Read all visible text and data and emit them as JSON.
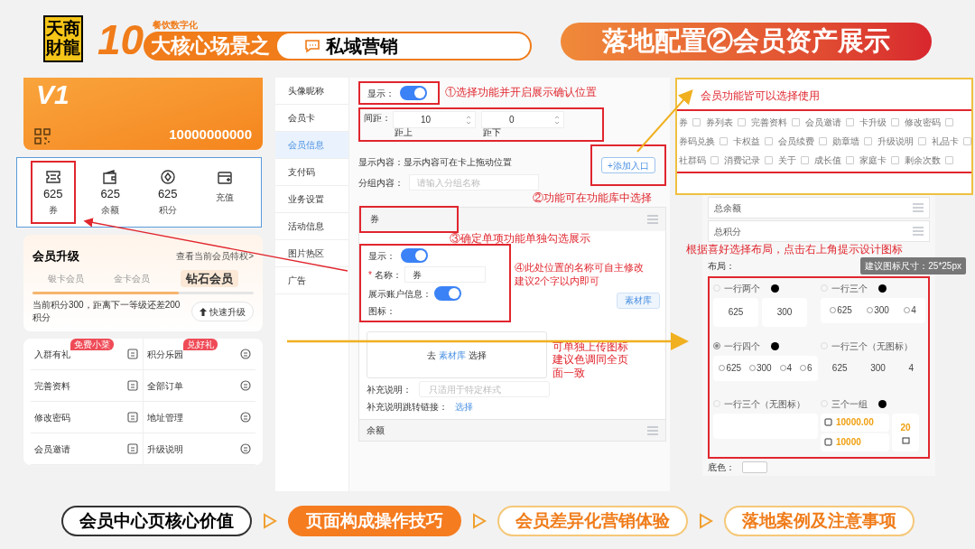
{
  "header": {
    "brand": "天商財龍",
    "series_tag": "餐饮数字化",
    "series_number": "10",
    "series_title": "大核心场景之",
    "topic": "私域营销",
    "slide_title": "落地配置②会员资产展示"
  },
  "phone": {
    "card_badge": "V1",
    "card_number": "10000000000",
    "assets": [
      {
        "kind": "stat",
        "value": "625",
        "label": "券",
        "highlighted": true
      },
      {
        "kind": "stat",
        "value": "625",
        "label": "余额",
        "highlighted": false
      },
      {
        "kind": "stat",
        "value": "625",
        "label": "积分",
        "highlighted": false
      },
      {
        "kind": "action",
        "label": "充值",
        "highlighted": false
      }
    ],
    "upgrade": {
      "title": "会员升级",
      "link": "查看当前会员特权>",
      "levels": [
        {
          "name": "银卡会员",
          "current": false
        },
        {
          "name": "金卡会员",
          "current": false
        },
        {
          "name": "钻石会员",
          "current": true
        }
      ],
      "level": 0.66,
      "note": "当前积分300，距离下一等级还差200积分",
      "button": "快速升级"
    },
    "menu": [
      {
        "label": "入群有礼",
        "badge": "免费小菜"
      },
      {
        "label": "积分乐园",
        "badge": "兑好礼"
      },
      {
        "label": "完善资料"
      },
      {
        "label": "全部订单"
      },
      {
        "label": "修改密码"
      },
      {
        "label": "地址管理"
      },
      {
        "label": "会员邀请"
      },
      {
        "label": "升级说明"
      }
    ]
  },
  "sidebar": {
    "items": [
      {
        "label": "头像昵称",
        "selected": false
      },
      {
        "label": "会员卡",
        "selected": false
      },
      {
        "label": "会员信息",
        "selected": true
      },
      {
        "label": "支付码",
        "selected": false
      },
      {
        "label": "业务设置",
        "selected": false
      },
      {
        "label": "活动信息",
        "selected": false
      },
      {
        "label": "图片热区",
        "selected": false
      },
      {
        "label": "广告",
        "selected": false
      }
    ]
  },
  "editor": {
    "show_label": "显示：",
    "show_on": true,
    "spacing_label": "间距：",
    "spacing": [
      {
        "value": "10",
        "caption": "距上"
      },
      {
        "value": "0",
        "caption": "距下"
      }
    ],
    "content_label": "显示内容：显示内容可在卡上拖动位置",
    "add_button": "+添加入口",
    "group_label": "分组内容：",
    "group_placeholder": "请输入分组名称",
    "item": {
      "title": "券",
      "show_label": "显示：",
      "show_on": true,
      "required_mark": "*",
      "name_label": "名称：",
      "name_value": "券",
      "account_label": "展示账户信息：",
      "account_on": true,
      "icon_label": "图标：",
      "library_button": "素材库",
      "upload_prefix": "去",
      "upload_link": "素材库",
      "upload_suffix": "选择",
      "note_label": "补充说明：",
      "note_placeholder": "只适用于特定样式",
      "link_label": "补充说明跳转链接：",
      "link_value": "选择"
    },
    "next_section": "余额"
  },
  "annotations": {
    "step1": "①选择功能并开启展示确认位置",
    "step2": "②功能可在功能库中选择",
    "step3": "③确定单项功能单独勾选展示",
    "step4": [
      "④此处位置的名称可自主修改",
      "建议2个字以内即可"
    ],
    "upload_note": [
      "可单独上传图标",
      "建议色调同全页",
      "面一致"
    ],
    "library_note": "会员功能皆可以选择使用",
    "layout_note": "根据喜好选择布局，点击右上角提示设计图标"
  },
  "library": {
    "rows": [
      [
        {
          "label": "券",
          "checked": false
        },
        {
          "label": "券列表",
          "checked": false
        },
        {
          "label": "完善资料",
          "checked": false
        },
        {
          "label": "会员邀请",
          "checked": false
        },
        {
          "label": "卡升级",
          "checked": false
        },
        {
          "label": "修改密码",
          "checked": false
        }
      ],
      [
        {
          "label": "券码兑换",
          "checked": false
        },
        {
          "label": "卡权益",
          "checked": false
        },
        {
          "label": "会员续费",
          "checked": false
        },
        {
          "label": "勋章墙",
          "checked": false
        },
        {
          "label": "升级说明",
          "checked": false
        },
        {
          "label": "礼品卡",
          "checked": false
        }
      ],
      [
        {
          "label": "社群码",
          "checked": false
        },
        {
          "label": "消费记录",
          "checked": false
        },
        {
          "label": "关于",
          "checked": false
        },
        {
          "label": "成长值",
          "checked": false
        },
        {
          "label": "家庭卡",
          "checked": false
        },
        {
          "label": "剩余次数",
          "checked": false
        }
      ]
    ]
  },
  "settings": {
    "rows": [
      "总余额",
      "总积分"
    ],
    "layout_label": "布局：",
    "tooltip": "建议图标尺寸：25*25px",
    "color_label": "底色：",
    "layouts": [
      {
        "label": "一行两个",
        "selected": false,
        "info": true,
        "kind": "cards",
        "values": [
          "625",
          "300"
        ]
      },
      {
        "label": "一行三个",
        "selected": false,
        "info": true,
        "kind": "icons",
        "values": [
          "625",
          "300",
          "4"
        ]
      },
      {
        "label": "一行四个",
        "selected": true,
        "info": true,
        "kind": "icons",
        "values": [
          "625",
          "300",
          "4",
          "6"
        ]
      },
      {
        "label": "一行三个（无图标）",
        "selected": false,
        "info": false,
        "kind": "plain",
        "values": [
          "625",
          "300",
          "4"
        ]
      },
      {
        "label": "一行三个（无图标）",
        "selected": false,
        "info": false,
        "kind": "blank"
      },
      {
        "label": "三个一组",
        "selected": false,
        "info": true,
        "kind": "group",
        "values": [
          "10000.00",
          "10000",
          "20"
        ]
      }
    ]
  },
  "footer": {
    "steps": [
      {
        "label": "会员中心页核心价值",
        "selected": false,
        "done": true
      },
      {
        "label": "页面构成操作技巧",
        "selected": true,
        "done": false
      },
      {
        "label": "会员差异化营销体验",
        "selected": false,
        "done": false
      },
      {
        "label": "落地案例及注意事项",
        "selected": false,
        "done": false
      }
    ]
  }
}
